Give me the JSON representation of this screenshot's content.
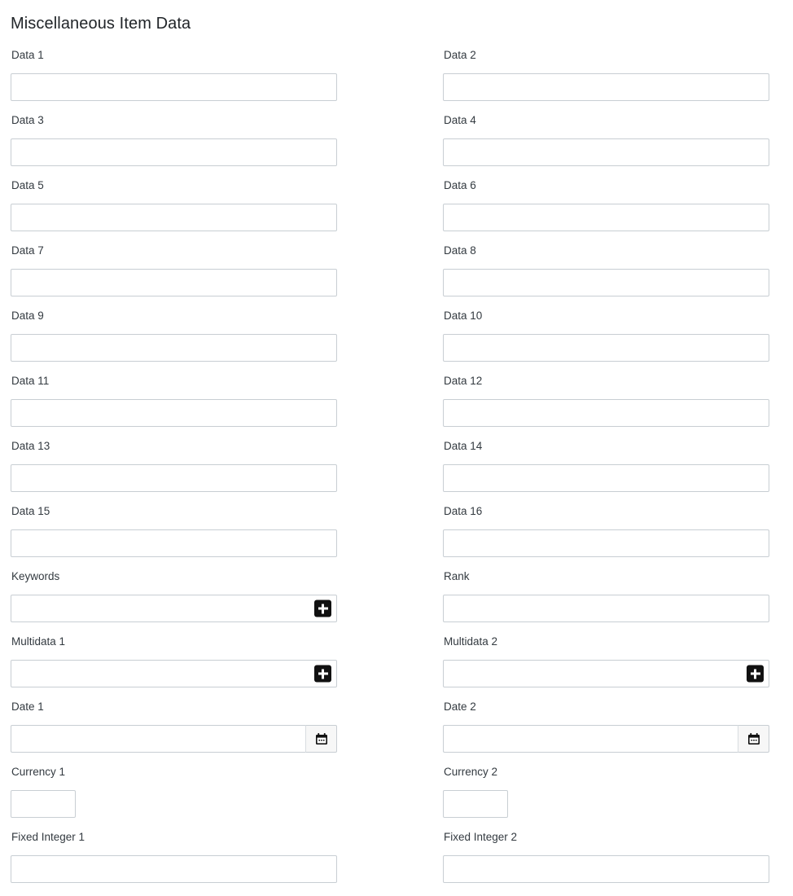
{
  "page": {
    "title": "Miscellaneous Item Data"
  },
  "icons": {
    "plus": "plus-icon",
    "calendar": "calendar-icon"
  },
  "form": {
    "left_column": [
      {
        "label": "Data 1",
        "value": "",
        "placeholder": "",
        "type": "text",
        "width": "full"
      },
      {
        "label": "Data 3",
        "value": "",
        "placeholder": "",
        "type": "text",
        "width": "full"
      },
      {
        "label": "Data 5",
        "value": "",
        "placeholder": "",
        "type": "text",
        "width": "full"
      },
      {
        "label": "Data 7",
        "value": "",
        "placeholder": "",
        "type": "text",
        "width": "full"
      },
      {
        "label": "Data 9",
        "value": "",
        "placeholder": "",
        "type": "text",
        "width": "full"
      },
      {
        "label": "Data 11",
        "value": "",
        "placeholder": "",
        "type": "text",
        "width": "full"
      },
      {
        "label": "Data 13",
        "value": "",
        "placeholder": "",
        "type": "text",
        "width": "full"
      },
      {
        "label": "Data 15",
        "value": "",
        "placeholder": "",
        "type": "text",
        "width": "full"
      },
      {
        "label": "Keywords",
        "value": "",
        "placeholder": "",
        "type": "multi",
        "width": "full"
      },
      {
        "label": "Multidata 1",
        "value": "",
        "placeholder": "",
        "type": "multi",
        "width": "full"
      },
      {
        "label": "Date 1",
        "value": "",
        "placeholder": "",
        "type": "date",
        "width": "full"
      },
      {
        "label": "Currency 1",
        "value": "",
        "placeholder": "",
        "type": "currency",
        "width": "narrow"
      },
      {
        "label": "Fixed Integer 1",
        "value": "",
        "placeholder": "",
        "type": "text",
        "width": "full"
      }
    ],
    "right_column": [
      {
        "label": "Data 2",
        "value": "",
        "placeholder": "",
        "type": "text",
        "width": "full"
      },
      {
        "label": "Data 4",
        "value": "",
        "placeholder": "",
        "type": "text",
        "width": "full"
      },
      {
        "label": "Data 6",
        "value": "",
        "placeholder": "",
        "type": "text",
        "width": "full"
      },
      {
        "label": "Data 8",
        "value": "",
        "placeholder": "",
        "type": "text",
        "width": "full"
      },
      {
        "label": "Data 10",
        "value": "",
        "placeholder": "",
        "type": "text",
        "width": "full"
      },
      {
        "label": "Data 12",
        "value": "",
        "placeholder": "",
        "type": "text",
        "width": "full"
      },
      {
        "label": "Data 14",
        "value": "",
        "placeholder": "",
        "type": "text",
        "width": "full"
      },
      {
        "label": "Data 16",
        "value": "",
        "placeholder": "",
        "type": "text",
        "width": "full"
      },
      {
        "label": "Rank",
        "value": "",
        "placeholder": "",
        "type": "text",
        "width": "full"
      },
      {
        "label": "Multidata 2",
        "value": "",
        "placeholder": "",
        "type": "multi",
        "width": "full"
      },
      {
        "label": "Date 2",
        "value": "",
        "placeholder": "",
        "type": "date",
        "width": "full"
      },
      {
        "label": "Currency 2",
        "value": "",
        "placeholder": "",
        "type": "currency",
        "width": "narrow"
      },
      {
        "label": "Fixed Integer 2",
        "value": "",
        "placeholder": "",
        "type": "text",
        "width": "full"
      }
    ]
  },
  "colors": {
    "text": "#212529",
    "label": "#333a40",
    "border": "#c8ced3",
    "button_dark": "#111111",
    "button_light": "#f7f7f7",
    "background": "#ffffff"
  }
}
